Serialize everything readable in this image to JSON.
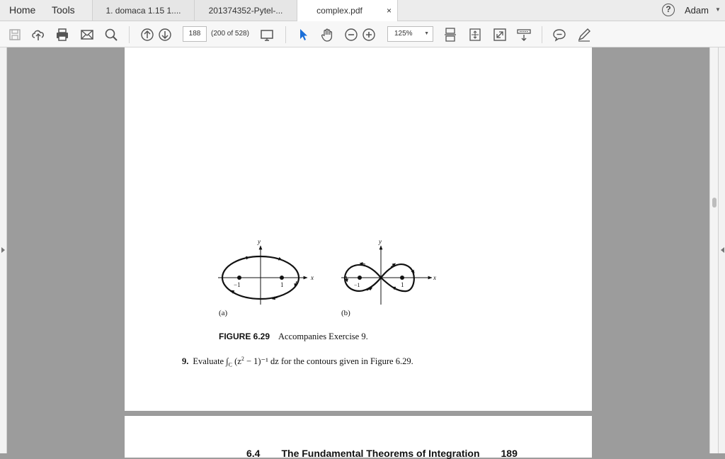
{
  "nav": {
    "home": "Home",
    "tools": "Tools"
  },
  "tabs": [
    {
      "label": "1. domaca 1.15 1...."
    },
    {
      "label": "201374352-Pytel-..."
    },
    {
      "label": "complex.pdf",
      "close": "×"
    }
  ],
  "user": {
    "help": "?",
    "name": "Adam"
  },
  "toolbar": {
    "page_number": "188",
    "page_count": "(200 of 528)",
    "zoom": "125%",
    "icons": [
      "save-icon",
      "upload-icon",
      "print-icon",
      "email-icon",
      "search-icon",
      "prev-page-icon",
      "next-page-icon",
      "page-display-icon",
      "select-arrow-icon",
      "hand-icon",
      "zoom-out-icon",
      "zoom-in-icon",
      "fit-width-icon",
      "fit-page-icon",
      "fullscreen-icon",
      "read-mode-icon",
      "comment-icon",
      "sign-icon"
    ]
  },
  "document": {
    "figure": {
      "label_a": "(a)",
      "label_b": "(b)",
      "axis_y": "y",
      "axis_x": "x",
      "tick_neg": "−1",
      "tick_pos": "1",
      "number": "FIGURE 6.29",
      "caption": "Accompanies Exercise 9."
    },
    "exercise": {
      "number": "9.",
      "text_before": "Evaluate ∫",
      "sub": "C",
      "integrand": " (z",
      "sup": "2",
      "text_after": " − 1)⁻¹ dz for the contours given in Figure 6.29."
    },
    "next_page_header": {
      "section": "6.4",
      "title": "The Fundamental Theorems of Integration",
      "page": "189"
    }
  }
}
